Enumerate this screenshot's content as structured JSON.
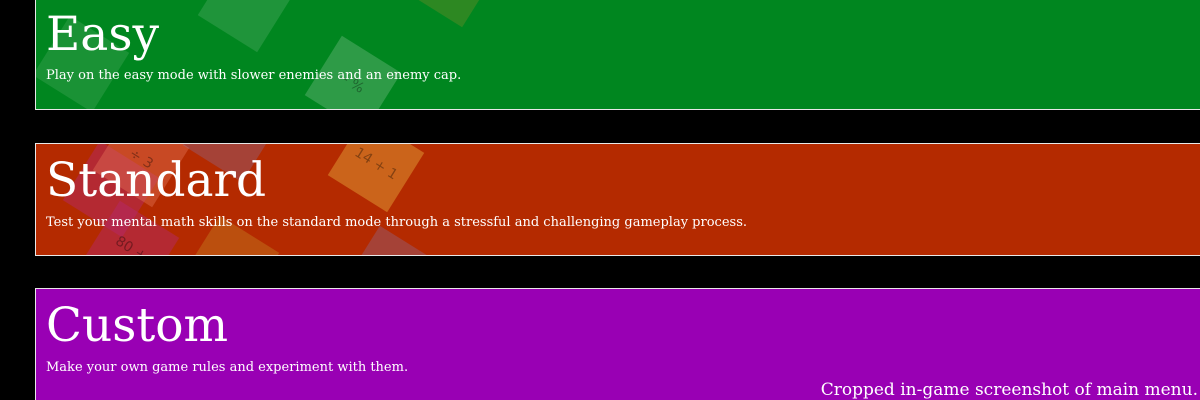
{
  "modes": [
    {
      "id": "easy",
      "title": "Easy",
      "description": "Play on the easy mode with slower enemies and an enemy cap.",
      "background": "#00861f",
      "tile_glyphs": [
        "",
        "- %"
      ]
    },
    {
      "id": "standard",
      "title": "Standard",
      "description": "Test your mental math skills on the standard mode through a stressful and challenging gameplay process.",
      "background": "#b42a00",
      "tile_glyphs": [
        "14 + 1",
        "80 +",
        "÷ 3"
      ]
    },
    {
      "id": "custom",
      "title": "Custom",
      "description": "Make your own game rules and experiment with them.",
      "background": "#9900b4"
    }
  ],
  "caption": "Cropped in-game screenshot of main menu."
}
